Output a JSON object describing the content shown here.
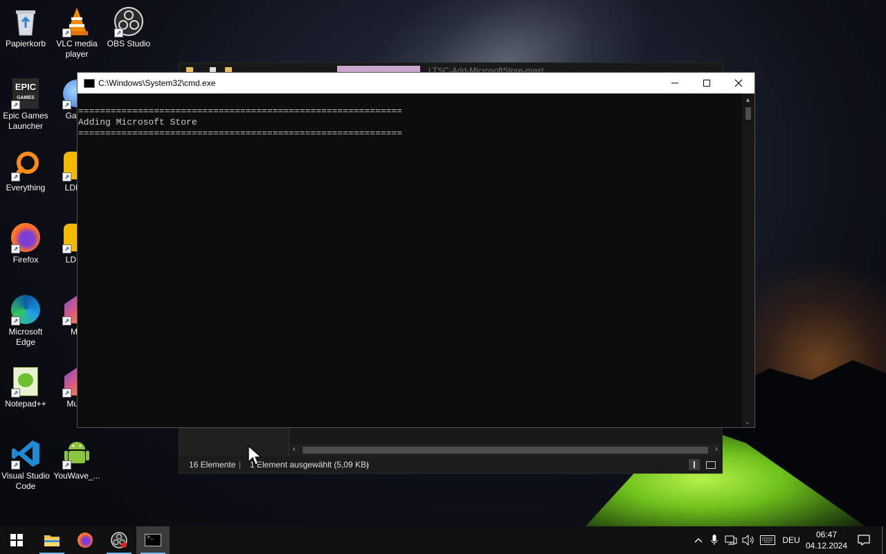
{
  "desktop": {
    "icons": [
      {
        "label": "Papierkorb",
        "icon": "recycle-bin-icon"
      },
      {
        "label": "VLC media player",
        "icon": "vlc-icon"
      },
      {
        "label": "OBS Studio",
        "icon": "obs-icon"
      },
      {
        "label": "Epic Games Launcher",
        "icon": "epic-games-icon"
      },
      {
        "label": "Game",
        "icon": "game-icon"
      },
      {
        "label": "Everything",
        "icon": "everything-icon"
      },
      {
        "label": "LDMul",
        "icon": "ldmultiplayer-icon"
      },
      {
        "label": "Firefox",
        "icon": "firefox-icon"
      },
      {
        "label": "LDPla",
        "icon": "ldplayer-icon"
      },
      {
        "label": "Microsoft Edge",
        "icon": "edge-icon"
      },
      {
        "label": "ME",
        "icon": "memu-icon"
      },
      {
        "label": "Notepad++",
        "icon": "notepadpp-icon"
      },
      {
        "label": "Multi-",
        "icon": "multi-icon"
      },
      {
        "label": "Visual Studio Code",
        "icon": "vscode-icon"
      },
      {
        "label": "YouWave_...",
        "icon": "android-icon"
      }
    ]
  },
  "explorer": {
    "title_partial": "LTSC-Add-MicrosoftStore-mast...",
    "status": {
      "count": "16 Elemente",
      "selection": "1 Element ausgewählt (5,09 KB)"
    }
  },
  "cmd": {
    "title": "C:\\Windows\\System32\\cmd.exe",
    "lines": [
      "",
      "============================================================",
      "Adding Microsoft Store",
      "============================================================"
    ],
    "buttons": {
      "minimize": "—",
      "maximize": "☐",
      "close": "✕"
    }
  },
  "taskbar": {
    "language": "DEU",
    "time": "06:47",
    "date": "04.12.2024",
    "apps": [
      "start-icon",
      "file-explorer-icon",
      "firefox-icon",
      "obs-icon",
      "cmd-icon"
    ]
  }
}
